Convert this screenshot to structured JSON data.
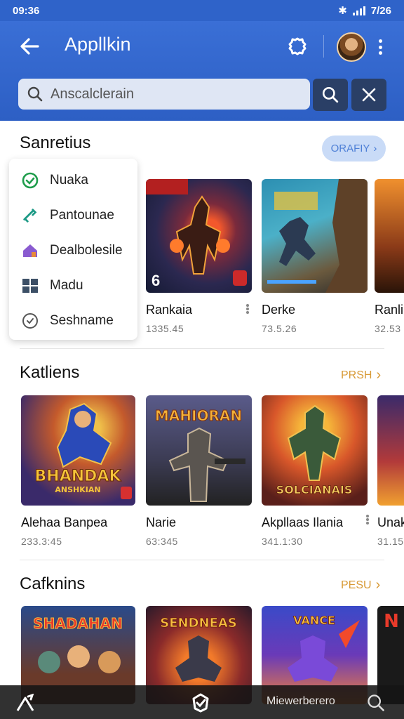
{
  "status": {
    "time": "09:36",
    "clock": "7/26"
  },
  "appbar": {
    "title": "Appllkin",
    "search_placeholder": "Anscalclerain"
  },
  "section1": {
    "title": "Sanretius",
    "more_label": "ORAFIY"
  },
  "menu": [
    {
      "label": "Nuaka",
      "icon": "check-circle-icon"
    },
    {
      "label": "Pantounae",
      "icon": "link-icon"
    },
    {
      "label": "Dealbolesile",
      "icon": "home-icon"
    },
    {
      "label": "Madu",
      "icon": "grid-icon"
    },
    {
      "label": "Seshname",
      "icon": "check-circle-outline-icon"
    }
  ],
  "row1": [
    {
      "name": "Rankaia",
      "meta": "1335.45",
      "badge": "6"
    },
    {
      "name": "Derke",
      "meta": "73.5.26"
    },
    {
      "name": "Ranli",
      "meta": "32.53"
    }
  ],
  "section2": {
    "title": "Katliens",
    "more_label": "PRSH"
  },
  "row2": [
    {
      "name": "Alehaa Banpea",
      "meta": "233.3:45",
      "art_text": "BHANDAK",
      "art_sub": "ANSHKIAN"
    },
    {
      "name": "Narie",
      "meta": "63:345",
      "art_text": "MAHIORAN"
    },
    {
      "name": "Akpllaas Ilania",
      "meta": "341.1:30",
      "art_text": "SOLCIANAIS"
    },
    {
      "name": "Unak",
      "meta": "31.15"
    }
  ],
  "section3": {
    "title": "Cafknins",
    "more_label": "PESU"
  },
  "row3": [
    {
      "art_text": "SHADAHAN"
    },
    {
      "art_text": "SENDNEAS"
    },
    {
      "art_text": "VANCE"
    },
    {
      "art_text": "N"
    }
  ],
  "bottom": {
    "label": "Miewerberero"
  },
  "colors": {
    "primary": "#2f63c9",
    "accent": "#d89a36",
    "dark_button": "#2a3f66"
  }
}
